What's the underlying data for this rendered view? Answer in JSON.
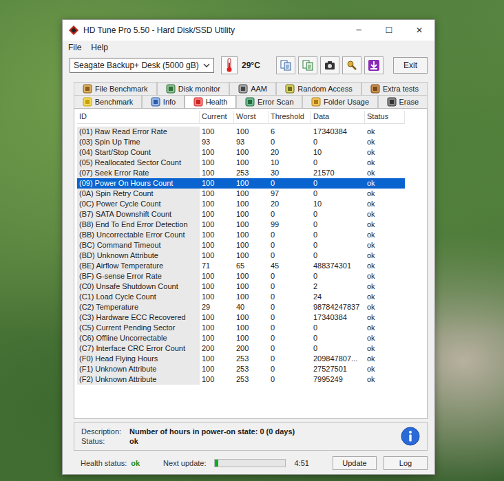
{
  "window": {
    "title": "HD Tune Pro 5.50 - Hard Disk/SSD Utility",
    "controls": [
      "─",
      "☐",
      "✕"
    ]
  },
  "menu": [
    "File",
    "Help"
  ],
  "toolbar": {
    "drive": "Seagate Backup+ Desk (5000 gB)",
    "temperature": "29°C",
    "exit": "Exit"
  },
  "tabs": [
    [
      {
        "label": "File Benchmark",
        "selected": false
      },
      {
        "label": "Disk monitor",
        "selected": false
      },
      {
        "label": "AAM",
        "selected": false
      },
      {
        "label": "Random Access",
        "selected": false
      },
      {
        "label": "Extra tests",
        "selected": false
      }
    ],
    [
      {
        "label": "Benchmark",
        "selected": false
      },
      {
        "label": "Info",
        "selected": false
      },
      {
        "label": "Health",
        "selected": true
      },
      {
        "label": "Error Scan",
        "selected": false
      },
      {
        "label": "Folder Usage",
        "selected": false
      },
      {
        "label": "Erase",
        "selected": false
      }
    ]
  ],
  "table": {
    "columns": [
      "ID",
      "Current",
      "Worst",
      "Threshold",
      "Data",
      "Status"
    ],
    "rows": [
      {
        "cells": [
          "(01) Raw Read Error Rate",
          "100",
          "100",
          "6",
          "17340384",
          "ok"
        ],
        "selected": false
      },
      {
        "cells": [
          "(03) Spin Up Time",
          "93",
          "93",
          "0",
          "0",
          "ok"
        ],
        "selected": false
      },
      {
        "cells": [
          "(04) Start/Stop Count",
          "100",
          "100",
          "20",
          "10",
          "ok"
        ],
        "selected": false
      },
      {
        "cells": [
          "(05) Reallocated Sector Count",
          "100",
          "100",
          "10",
          "0",
          "ok"
        ],
        "selected": false
      },
      {
        "cells": [
          "(07) Seek Error Rate",
          "100",
          "253",
          "30",
          "21570",
          "ok"
        ],
        "selected": false
      },
      {
        "cells": [
          "(09) Power On Hours Count",
          "100",
          "100",
          "0",
          "0",
          "ok"
        ],
        "selected": true
      },
      {
        "cells": [
          "(0A) Spin Retry Count",
          "100",
          "100",
          "97",
          "0",
          "ok"
        ],
        "selected": false
      },
      {
        "cells": [
          "(0C) Power Cycle Count",
          "100",
          "100",
          "20",
          "10",
          "ok"
        ],
        "selected": false
      },
      {
        "cells": [
          "(B7) SATA Downshift Count",
          "100",
          "100",
          "0",
          "0",
          "ok"
        ],
        "selected": false
      },
      {
        "cells": [
          "(B8) End To End Error Detection",
          "100",
          "100",
          "99",
          "0",
          "ok"
        ],
        "selected": false
      },
      {
        "cells": [
          "(BB) Uncorrectable Error Count",
          "100",
          "100",
          "0",
          "0",
          "ok"
        ],
        "selected": false
      },
      {
        "cells": [
          "(BC) Command Timeout",
          "100",
          "100",
          "0",
          "0",
          "ok"
        ],
        "selected": false
      },
      {
        "cells": [
          "(BD) Unknown Attribute",
          "100",
          "100",
          "0",
          "0",
          "ok"
        ],
        "selected": false
      },
      {
        "cells": [
          "(BE) Airflow Temperature",
          "71",
          "65",
          "45",
          "488374301",
          "ok"
        ],
        "selected": false
      },
      {
        "cells": [
          "(BF) G-sense Error Rate",
          "100",
          "100",
          "0",
          "0",
          "ok"
        ],
        "selected": false
      },
      {
        "cells": [
          "(C0) Unsafe Shutdown Count",
          "100",
          "100",
          "0",
          "2",
          "ok"
        ],
        "selected": false
      },
      {
        "cells": [
          "(C1) Load Cycle Count",
          "100",
          "100",
          "0",
          "24",
          "ok"
        ],
        "selected": false
      },
      {
        "cells": [
          "(C2) Temperature",
          "29",
          "40",
          "0",
          "98784247837",
          "ok"
        ],
        "selected": false
      },
      {
        "cells": [
          "(C3) Hardware ECC Recovered",
          "100",
          "100",
          "0",
          "17340384",
          "ok"
        ],
        "selected": false
      },
      {
        "cells": [
          "(C5) Current Pending Sector",
          "100",
          "100",
          "0",
          "0",
          "ok"
        ],
        "selected": false
      },
      {
        "cells": [
          "(C6) Offline Uncorrectable",
          "100",
          "100",
          "0",
          "0",
          "ok"
        ],
        "selected": false
      },
      {
        "cells": [
          "(C7) Interface CRC Error Count",
          "200",
          "200",
          "0",
          "0",
          "ok"
        ],
        "selected": false
      },
      {
        "cells": [
          "(F0) Head Flying Hours",
          "100",
          "253",
          "0",
          "209847807...",
          "ok"
        ],
        "selected": false
      },
      {
        "cells": [
          "(F1) Unknown Attribute",
          "100",
          "253",
          "0",
          "27527501",
          "ok"
        ],
        "selected": false
      },
      {
        "cells": [
          "(F2) Unknown Attribute",
          "100",
          "253",
          "0",
          "7995249",
          "ok"
        ],
        "selected": false
      }
    ]
  },
  "description": {
    "label": "Description:",
    "text": "Number of hours in power-on state: 0 (0 days)",
    "status_label": "Status:",
    "status": "ok"
  },
  "footer": {
    "health_label": "Health status:",
    "health": "ok",
    "next_label": "Next update:",
    "level": 0.04,
    "time": "4:51",
    "buttons": [
      "Update",
      "Log"
    ]
  }
}
